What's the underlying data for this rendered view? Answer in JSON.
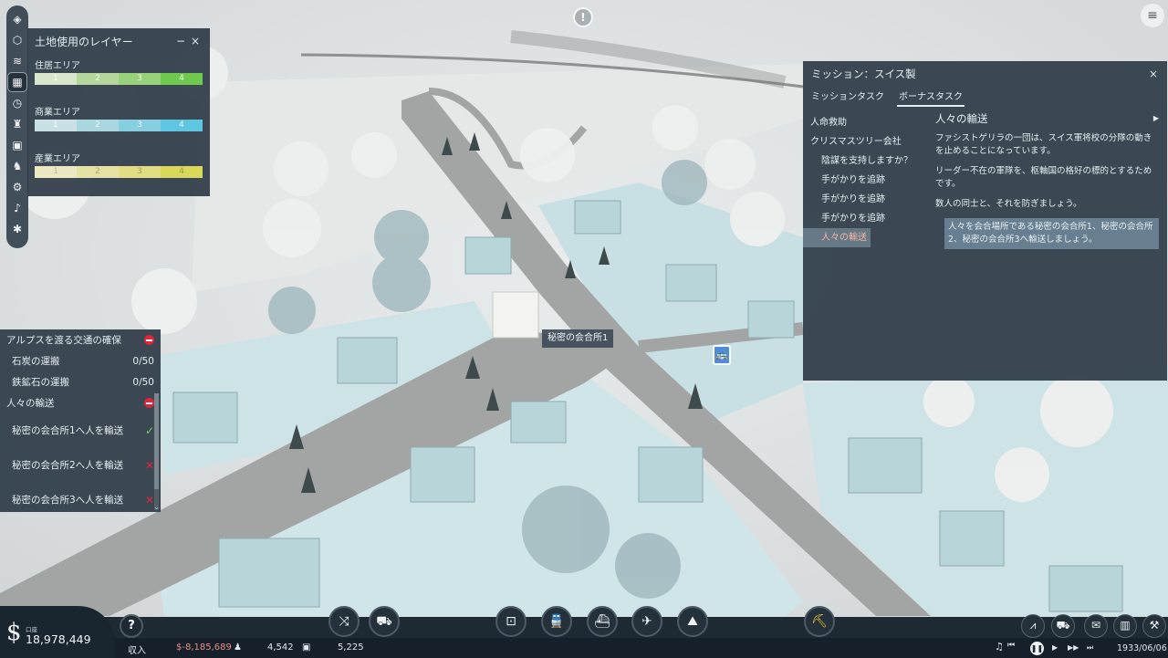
{
  "world": {
    "notify_glyph": "!",
    "menu_glyph": "≡",
    "map_label": "秘密の会合所1",
    "bus_marker_glyph": "🚌",
    "colors": {
      "snow": "#d8e6e8",
      "road": "#9a9c9c",
      "tint": "#c6e3e7"
    }
  },
  "left_toolbar": {
    "icons": [
      "layers-icon",
      "land-use-icon",
      "waves-icon",
      "map-overlay-icon",
      "clock-icon",
      "population-icon",
      "cargo-box-icon",
      "vehicles-icon",
      "production-icon",
      "audio-icon",
      "settings-icon"
    ]
  },
  "layer_panel": {
    "title": "土地使用のレイヤー",
    "min_btn": "−",
    "close_btn": "×",
    "sections": [
      {
        "label": "住居エリア",
        "levels": [
          "1",
          "2",
          "3",
          "4"
        ],
        "colors": [
          "#d8e7cb",
          "#b6d79c",
          "#98d27a",
          "#6fc94d"
        ]
      },
      {
        "label": "商業エリア",
        "levels": [
          "1",
          "2",
          "3",
          "4"
        ],
        "colors": [
          "#c9e1e4",
          "#a9d6df",
          "#86cfdf",
          "#5fc6e1"
        ]
      },
      {
        "label": "産業エリア",
        "levels": [
          "1",
          "2",
          "3",
          "4"
        ],
        "colors": [
          "#ece8c4",
          "#e5e3a4",
          "#e0dd82",
          "#d9d85b"
        ]
      }
    ]
  },
  "mission_panel": {
    "title": "ミッション：スイス製",
    "close_btn": "×",
    "tabs": [
      "ミッションタスク",
      "ボーナスタスク"
    ],
    "tasks": [
      "人命救助",
      "クリスマスツリー会社",
      "陰謀を支持しますか？",
      "手がかりを追跡",
      "手がかりを追跡",
      "手がかりを追跡",
      "人々の輸送"
    ],
    "detail": {
      "title": "人々の輸送",
      "expand_glyph": "▶",
      "p1": "ファシストゲリラの一団は、スイス軍将校の分隊の動きを止めることになっています。",
      "p2": "リーダー不在の軍隊を、枢軸国の格好の標的とするためです。",
      "p3": "数人の同士と、それを防ぎましょう。",
      "highlight": "人々を会合場所である秘密の会合所1、秘密の会合所2、秘密の会合所3へ輸送しましょう。"
    }
  },
  "objectives": {
    "group1": {
      "title": "アルプスを渡る交通の確保",
      "items": [
        {
          "label": "石炭の運搬",
          "value": "0/50"
        },
        {
          "label": "鉄鉱石の運搬",
          "value": "0/50"
        }
      ]
    },
    "group2": {
      "title": "人々の輸送",
      "items": [
        {
          "label": "秘密の会合所1へ人を輸送",
          "status": "✓"
        },
        {
          "label": "秘密の会合所2へ人を輸送",
          "status": "✕"
        },
        {
          "label": "秘密の会合所3へ人を輸送",
          "status": "✕"
        }
      ]
    },
    "scroll_glyph": "⌄"
  },
  "bottom_bar": {
    "currency_symbol": "$",
    "balance_label": "口座",
    "balance": "18,978,449",
    "help_glyph": "?",
    "income_label": "収入",
    "income": "$-8,185,689",
    "population": "4,542",
    "cargo": "5,225",
    "date": "1933/06/06",
    "speed_glyphs": {
      "music": "♫",
      "rewind": "⏮",
      "pause": "❚❚",
      "play": "▶",
      "fast": "▶▶",
      "faster": "⏭"
    }
  }
}
